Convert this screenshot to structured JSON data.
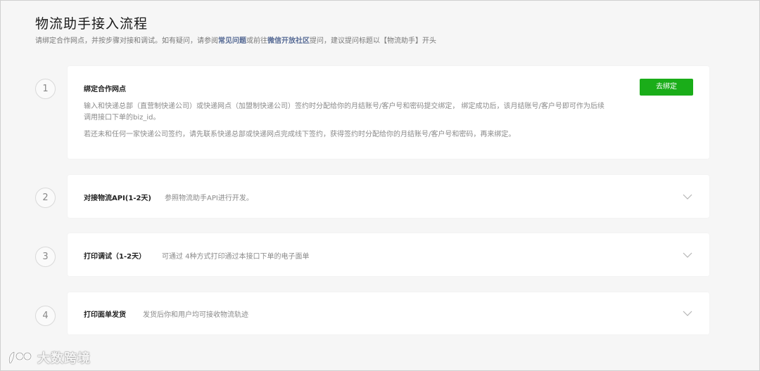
{
  "header": {
    "title": "物流助手接入流程",
    "subtitle_pre": "请绑定合作网点，并按步骤对接和调试。如有疑问，请参阅",
    "faq_link": "常见问题",
    "subtitle_mid": "或前往",
    "community_link": "微信开放社区",
    "subtitle_post": "提问，建议提问标题以【物流助手】开头"
  },
  "steps": [
    {
      "number": "1",
      "title": "绑定合作网点",
      "button_label": "去绑定",
      "paragraph1": "输入和快递总部（直营制快递公司）或快递网点（加盟制快递公司）签约时分配给你的月结账号/客户号和密码提交绑定， 绑定成功后，该月结账号/客户号即可作为后续调用接口下单的biz_id。",
      "paragraph2": "若还未和任何一家快递公司签约，请先联系快递总部或快递网点完成线下签约，获得签约时分配给你的月结账号/客户号和密码，再来绑定。"
    },
    {
      "number": "2",
      "title": "对接物流API(1-2天)",
      "desc": "参照物流助手API进行开发。"
    },
    {
      "number": "3",
      "title": "打印调试（1-2天）",
      "desc": "可通过 4种方式打印通过本接口下单的电子面单"
    },
    {
      "number": "4",
      "title": "打印面单发货",
      "desc": "发货后你和用户均可接收物流轨迹"
    }
  ],
  "watermark": {
    "logo_icon": "dashu-logo-icon",
    "text": "大数跨境"
  }
}
